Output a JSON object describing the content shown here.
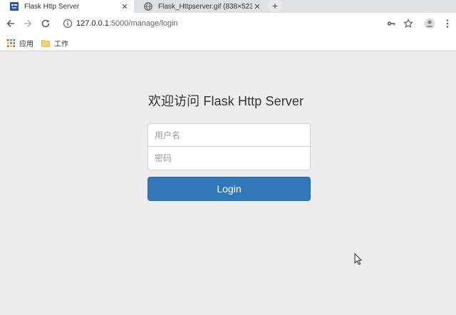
{
  "browser": {
    "tabs": [
      {
        "title": "Flask Http Server",
        "active": true,
        "favicon": "flask-favicon-icon"
      },
      {
        "title": "Flask_Httpserver.gif (838×523)",
        "active": false,
        "favicon": "globe-icon"
      }
    ],
    "new_tab_label": "+",
    "close_glyph": "✕",
    "address": {
      "host": "127.0.0.1",
      "rest": ":5000/manage/login"
    },
    "bookmarks": [
      {
        "label": "应用",
        "icon": "apps-grid-icon"
      },
      {
        "label": "工作",
        "icon": "folder-icon"
      }
    ],
    "accent": "#3178b8"
  },
  "page": {
    "heading": "欢迎访问 Flask Http Server",
    "username_placeholder": "用户名",
    "password_placeholder": "密码",
    "login_label": "Login"
  }
}
